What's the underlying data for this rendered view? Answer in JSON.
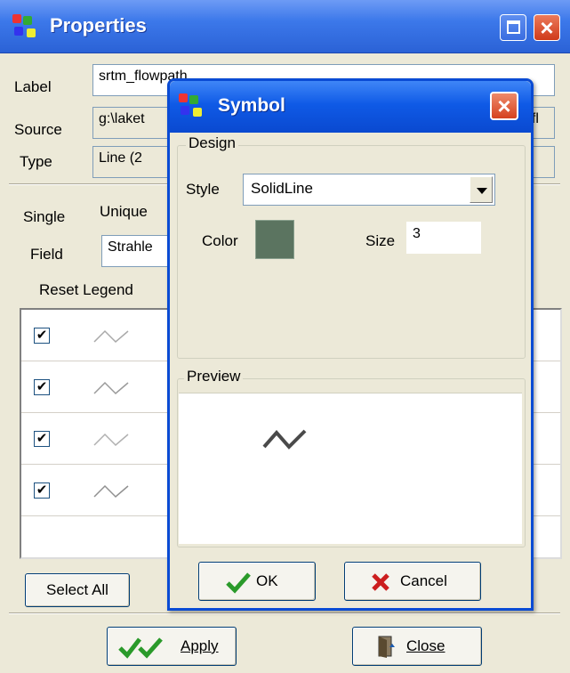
{
  "window": {
    "title": "Properties",
    "label": {
      "caption": "Label",
      "value": "srtm_flowpath"
    },
    "source": {
      "caption": "Source",
      "value": "g:\\laket",
      "suffix": "_fl"
    },
    "type": {
      "caption": "Type",
      "value": "Line  (2"
    },
    "tabs": [
      "Single",
      "Unique"
    ],
    "field": {
      "caption": "Field",
      "value": "Strahle"
    },
    "reset_legend_label": "Reset Legend",
    "select_all_label": "Select All",
    "apply_label": "Apply",
    "close_label": "Close",
    "legend_rows": [
      {
        "checked": true,
        "check_glyph": "✔"
      },
      {
        "checked": true,
        "check_glyph": "✔"
      },
      {
        "checked": true,
        "check_glyph": "✔"
      },
      {
        "checked": true,
        "check_glyph": "✔"
      }
    ]
  },
  "symbol_dialog": {
    "title": "Symbol",
    "design_caption": "Design",
    "style_label": "Style",
    "style_value": "SolidLine",
    "color_label": "Color",
    "color_value": "#5b7460",
    "size_label": "Size",
    "size_value": "3",
    "preview_caption": "Preview",
    "ok_label": "OK",
    "cancel_label": "Cancel"
  },
  "icons": {
    "app": "app-grid-icon",
    "maximize": "maximize-icon",
    "close": "close-icon",
    "ok": "checkmark-icon",
    "cancel": "red-x-icon",
    "apply": "double-checkmark-icon",
    "door": "door-icon"
  }
}
